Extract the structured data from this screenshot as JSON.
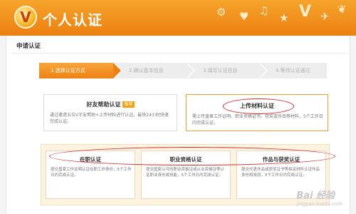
{
  "header": {
    "logo_letter": "V",
    "title": "个人认证"
  },
  "panel": {
    "title": "申请认证"
  },
  "steps": [
    {
      "label": "1.选择认证方式",
      "active": true
    },
    {
      "label": "2.确认基本信息",
      "active": false
    },
    {
      "label": "3.填写认证信息",
      "active": false
    },
    {
      "label": "4.等待认证通过",
      "active": false
    }
  ],
  "options": {
    "friend_help": {
      "title": "好友帮助认证",
      "badge": "推荐",
      "desc": "通过邀请五位V字友帮助+上传材料进行认证，最快24小时快速完成认证。"
    },
    "upload": {
      "title": "上传材料认证",
      "desc": "需上传盖章工作证明、职业资格证书、获奖或作品等材料，5个工作日内完成认证。"
    }
  },
  "sub_options": [
    {
      "title": "在职认证",
      "desc": "提交盖章工作证明认证在职工作身份，5个工作日内完成认证。"
    },
    {
      "title": "职业资格认证",
      "desc": "提交国家认可的职业资格证或从业资格证等认证职业身份或技能，5个工作日内完成认证。"
    },
    {
      "title": "作品与获奖认证",
      "desc": "提交代表作品或获奖证书等相关材料认证作品身份和成就，5个工作日内完成认证。"
    }
  ],
  "watermark": {
    "text": "Bai 经验",
    "sub": "jingyan.baidu.com"
  },
  "colors": {
    "brand_orange": "#ef8515",
    "annotation_red": "#d8282a"
  }
}
